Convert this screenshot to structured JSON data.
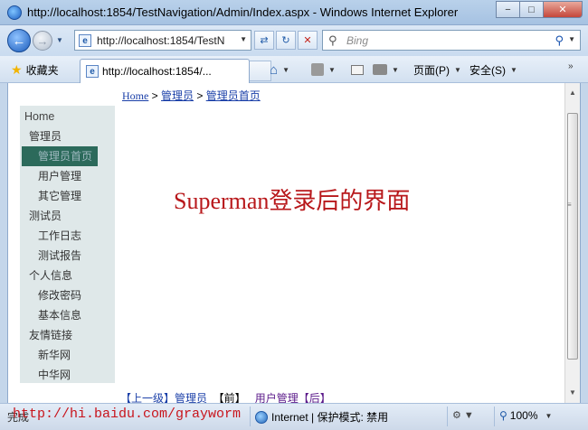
{
  "window": {
    "title": "http://localhost:1854/TestNavigation/Admin/Index.aspx - Windows Internet Explorer",
    "min_glyph": "−",
    "max_glyph": "□",
    "close_glyph": "✕"
  },
  "nav": {
    "back_glyph": "←",
    "forward_glyph": "→",
    "address": "http://localhost:1854/TestN",
    "search_placeholder": "Bing"
  },
  "tabs": {
    "favorites_label": "收藏夹",
    "tab_title": "http://localhost:1854/...",
    "commands": {
      "page_label": "页面(P)",
      "safety_label": "安全(S)"
    }
  },
  "page": {
    "breadcrumb": {
      "home": "Home",
      "sep1": " > ",
      "section": "管理员",
      "sep2": "  > ",
      "current": "管理员首页"
    },
    "sidebar": {
      "items": [
        {
          "label": "Home",
          "level": 0
        },
        {
          "label": "管理员",
          "level": 1
        },
        {
          "label": "管理员首页",
          "level": 2,
          "active": true
        },
        {
          "label": "用户管理",
          "level": 2
        },
        {
          "label": "其它管理",
          "level": 2
        },
        {
          "label": "测试员",
          "level": 1
        },
        {
          "label": "工作日志",
          "level": 2
        },
        {
          "label": "测试报告",
          "level": 2
        },
        {
          "label": "个人信息",
          "level": 1
        },
        {
          "label": "修改密码",
          "level": 2
        },
        {
          "label": "基本信息",
          "level": 2
        },
        {
          "label": "友情链接",
          "level": 1
        },
        {
          "label": "新华网",
          "level": 2
        },
        {
          "label": "中华网",
          "level": 2
        }
      ]
    },
    "heading": "Superman登录后的界面",
    "pager": {
      "prev_link": "【上一级】管理员",
      "current": "  【前】   ",
      "next_link": "用户管理【后】"
    },
    "colors": {
      "heading": "#b8181b",
      "sidebar_bg": "#dfe8e9",
      "sidebar_active": "#2c6a5b"
    }
  },
  "status": {
    "done": "完成",
    "url_watermark": "http://hi.baidu.com/grayworm",
    "zone": "Internet | 保护模式: 禁用",
    "zoom": "100%"
  }
}
